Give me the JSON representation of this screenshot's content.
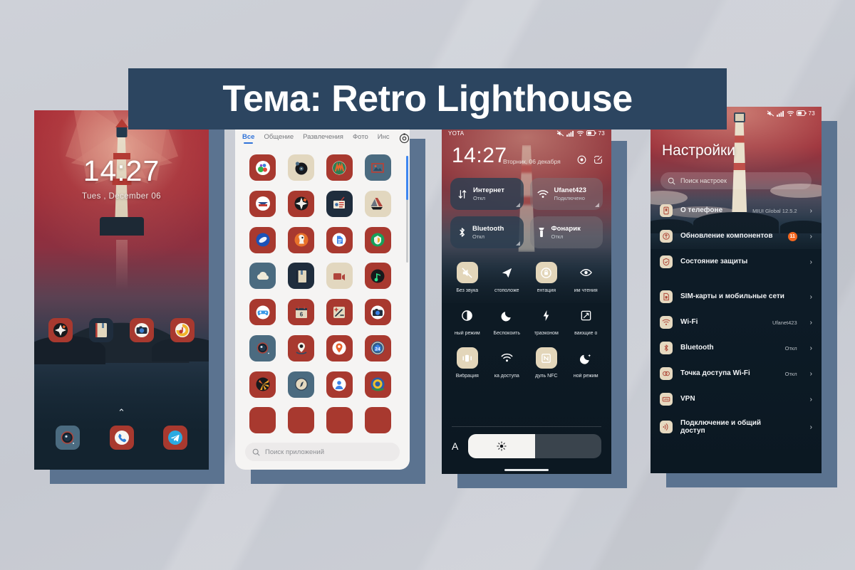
{
  "banner": {
    "title": "Тема: Retro Lighthouse",
    "bg_color": "#2c4560",
    "text_color": "#ffffff"
  },
  "page": {
    "background_color": "#c8cbd2",
    "shadow_color": "#5b7390"
  },
  "lockscreen": {
    "time": "14:27",
    "date": "Tues , December 06",
    "shortcuts": [
      {
        "name": "browser-icon",
        "bg": "red"
      },
      {
        "name": "notes-icon",
        "bg": "navy"
      },
      {
        "name": "camera-icon",
        "bg": "red"
      },
      {
        "name": "music-icon",
        "bg": "red"
      }
    ],
    "dock": [
      {
        "name": "camera-icon",
        "bg": "steel"
      },
      {
        "name": "phone-icon",
        "bg": "red"
      },
      {
        "name": "telegram-icon",
        "bg": "red"
      }
    ],
    "gesture_hint": "⌃"
  },
  "drawer": {
    "tabs": [
      {
        "label": "Все",
        "active": true
      },
      {
        "label": "Общение",
        "active": false
      },
      {
        "label": "Развлечения",
        "active": false
      },
      {
        "label": "Фото",
        "active": false
      },
      {
        "label": "Инс",
        "active": false
      }
    ],
    "settings_icon": "gear-icon",
    "search_placeholder": "Поиск приложений",
    "accent_color": "#2f72d8",
    "icons": [
      {
        "name": "gallery-dots-icon",
        "bg": "red"
      },
      {
        "name": "record-player-icon",
        "bg": "beige"
      },
      {
        "name": "yandex-music-icon",
        "bg": "red"
      },
      {
        "name": "photos-icon",
        "bg": "steel"
      },
      {
        "name": "pochta-icon",
        "bg": "red"
      },
      {
        "name": "compass-ball-icon",
        "bg": "red"
      },
      {
        "name": "news-icon",
        "bg": "navy"
      },
      {
        "name": "google-drive-icon",
        "bg": "beige"
      },
      {
        "name": "blue-disc-icon",
        "bg": "red"
      },
      {
        "name": "duckduckgo-icon",
        "bg": "red"
      },
      {
        "name": "docs-icon",
        "bg": "red"
      },
      {
        "name": "green-shield-icon",
        "bg": "red"
      },
      {
        "name": "cloud-icon",
        "bg": "steel"
      },
      {
        "name": "book-icon",
        "bg": "navy"
      },
      {
        "name": "video-icon",
        "bg": "beige"
      },
      {
        "name": "spotify-icon",
        "bg": "red"
      },
      {
        "name": "games-icon",
        "bg": "red"
      },
      {
        "name": "calendar-icon",
        "bg": "red"
      },
      {
        "name": "calculator-icon",
        "bg": "red"
      },
      {
        "name": "camera-icon",
        "bg": "red"
      },
      {
        "name": "camera-lens-icon",
        "bg": "steel"
      },
      {
        "name": "location-pin-icon",
        "bg": "red"
      },
      {
        "name": "maps-pin-icon",
        "bg": "red"
      },
      {
        "name": "24-badge-icon",
        "bg": "red"
      },
      {
        "name": "burst-icon",
        "bg": "red"
      },
      {
        "name": "compass-icon",
        "bg": "steel"
      },
      {
        "name": "contacts-icon",
        "bg": "red"
      },
      {
        "name": "ring-icon",
        "bg": "red"
      },
      {
        "name": "app-icon-a",
        "bg": "red"
      },
      {
        "name": "app-icon-b",
        "bg": "red"
      },
      {
        "name": "app-icon-c",
        "bg": "red"
      },
      {
        "name": "app-icon-d",
        "bg": "red"
      }
    ],
    "calendar_day": "6"
  },
  "control_center": {
    "carrier": "YOTA",
    "battery": "73",
    "time": "14:27",
    "date": "Вторник, 06 декабря",
    "big_tiles": [
      {
        "title": "Интернет",
        "subtitle": "Откл",
        "icon": "data-transfer-icon",
        "state": "on"
      },
      {
        "title": "Ufanet423",
        "subtitle": "Подключено",
        "icon": "wifi-icon",
        "state": "off"
      },
      {
        "title": "Bluetooth",
        "subtitle": "Откл",
        "icon": "bluetooth-icon",
        "state": "on"
      },
      {
        "title": "Фонарик",
        "subtitle": "Откл",
        "icon": "flashlight-icon",
        "state": "off"
      }
    ],
    "toggles": [
      {
        "label": "Без звука",
        "icon": "mute-icon",
        "active": true
      },
      {
        "label": "стоположе",
        "icon": "location-arrow-icon",
        "active": false
      },
      {
        "label": "ентация",
        "icon": "rotation-lock-icon",
        "active": true
      },
      {
        "label": "им чтения",
        "icon": "eye-icon",
        "active": false
      },
      {
        "label": "ный режим",
        "icon": "contrast-icon",
        "active": false
      },
      {
        "label": "Беспокоить",
        "icon": "moon-icon",
        "active": false
      },
      {
        "label": "траэконом",
        "icon": "lightning-icon",
        "active": false
      },
      {
        "label": "вающие о",
        "icon": "screenshot-icon",
        "active": false
      },
      {
        "label": "Вибрация",
        "icon": "vibration-icon",
        "active": true
      },
      {
        "label": "ка доступа",
        "icon": "hotspot-icon",
        "active": false
      },
      {
        "label": "дуль NFC",
        "icon": "nfc-icon",
        "active": true
      },
      {
        "label": "ной режим",
        "icon": "night-mode-icon",
        "active": false
      }
    ],
    "brightness": {
      "auto_label": "A",
      "value_percent": 50,
      "icon": "sun-icon"
    }
  },
  "settings": {
    "battery": "73",
    "title": "Настройки",
    "search_placeholder": "Поиск настроек",
    "items": [
      {
        "label": "О телефоне",
        "value": "MIUI Global 12.5.2",
        "icon": "phone-info-icon",
        "badge": ""
      },
      {
        "label": "Обновление компонентов",
        "value": "",
        "icon": "update-icon",
        "badge": "11"
      },
      {
        "label": "Состояние защиты",
        "value": "",
        "icon": "shield-icon",
        "badge": ""
      },
      {
        "label": "SIM-карты и мобильные сети",
        "value": "",
        "icon": "sim-card-icon",
        "badge": ""
      },
      {
        "label": "Wi-Fi",
        "value": "Ufanet423",
        "icon": "wifi-icon",
        "badge": ""
      },
      {
        "label": "Bluetooth",
        "value": "Откл",
        "icon": "bluetooth-icon",
        "badge": ""
      },
      {
        "label": "Точка доступа Wi-Fi",
        "value": "Откл",
        "icon": "hotspot-icon",
        "badge": ""
      },
      {
        "label": "VPN",
        "value": "",
        "icon": "vpn-icon",
        "badge": ""
      },
      {
        "label": "Подключение и общий доступ",
        "value": "",
        "icon": "sharing-icon",
        "badge": ""
      }
    ],
    "chevron": "›",
    "badge_color": "#f4671f"
  }
}
